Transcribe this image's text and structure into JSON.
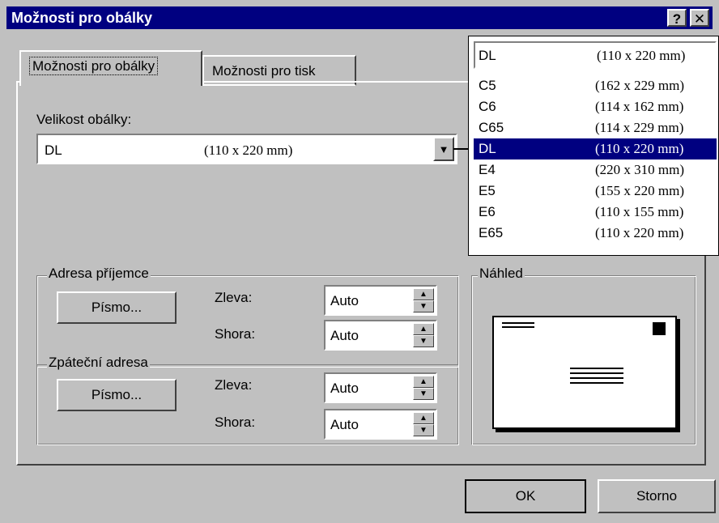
{
  "titlebar": {
    "title": "Možnosti pro obálky",
    "help_label": "?",
    "close_label": "✕"
  },
  "tabs": [
    {
      "label": "Možnosti pro obálky",
      "active": true
    },
    {
      "label": "Možnosti pro tisk",
      "active": false
    }
  ],
  "envelope_size": {
    "label": "Velikost obálky:",
    "selected_name": "DL",
    "selected_size": "(110 x 220 mm)"
  },
  "dropdown": {
    "header_name": "DL",
    "header_size": "(110 x 220 mm)",
    "items": [
      {
        "name": "C5",
        "size": "(162 x 229 mm)"
      },
      {
        "name": "C6",
        "size": "(114 x 162 mm)"
      },
      {
        "name": "C65",
        "size": "(114 x 229 mm)"
      },
      {
        "name": "DL",
        "size": "(110 x 220 mm)",
        "selected": true
      },
      {
        "name": "E4",
        "size": "(220 x 310 mm)"
      },
      {
        "name": "E5",
        "size": "(155 x 220 mm)"
      },
      {
        "name": "E6",
        "size": "(110 x 155 mm)"
      },
      {
        "name": "E65",
        "size": "(110 x 220 mm)"
      }
    ]
  },
  "recipient": {
    "group_label": "Adresa příjemce",
    "font_button": "Písmo...",
    "left_label": "Zleva:",
    "left_value": "Auto",
    "top_label": "Shora:",
    "top_value": "Auto"
  },
  "return_address": {
    "group_label": "Zpáteční adresa",
    "font_button": "Písmo...",
    "left_label": "Zleva:",
    "left_value": "Auto",
    "top_label": "Shora:",
    "top_value": "Auto"
  },
  "preview": {
    "group_label": "Náhled"
  },
  "buttons": {
    "ok": "OK",
    "cancel": "Storno"
  },
  "colors": {
    "face": "#c0c0c0",
    "title": "#000080",
    "highlight": "#000080"
  }
}
